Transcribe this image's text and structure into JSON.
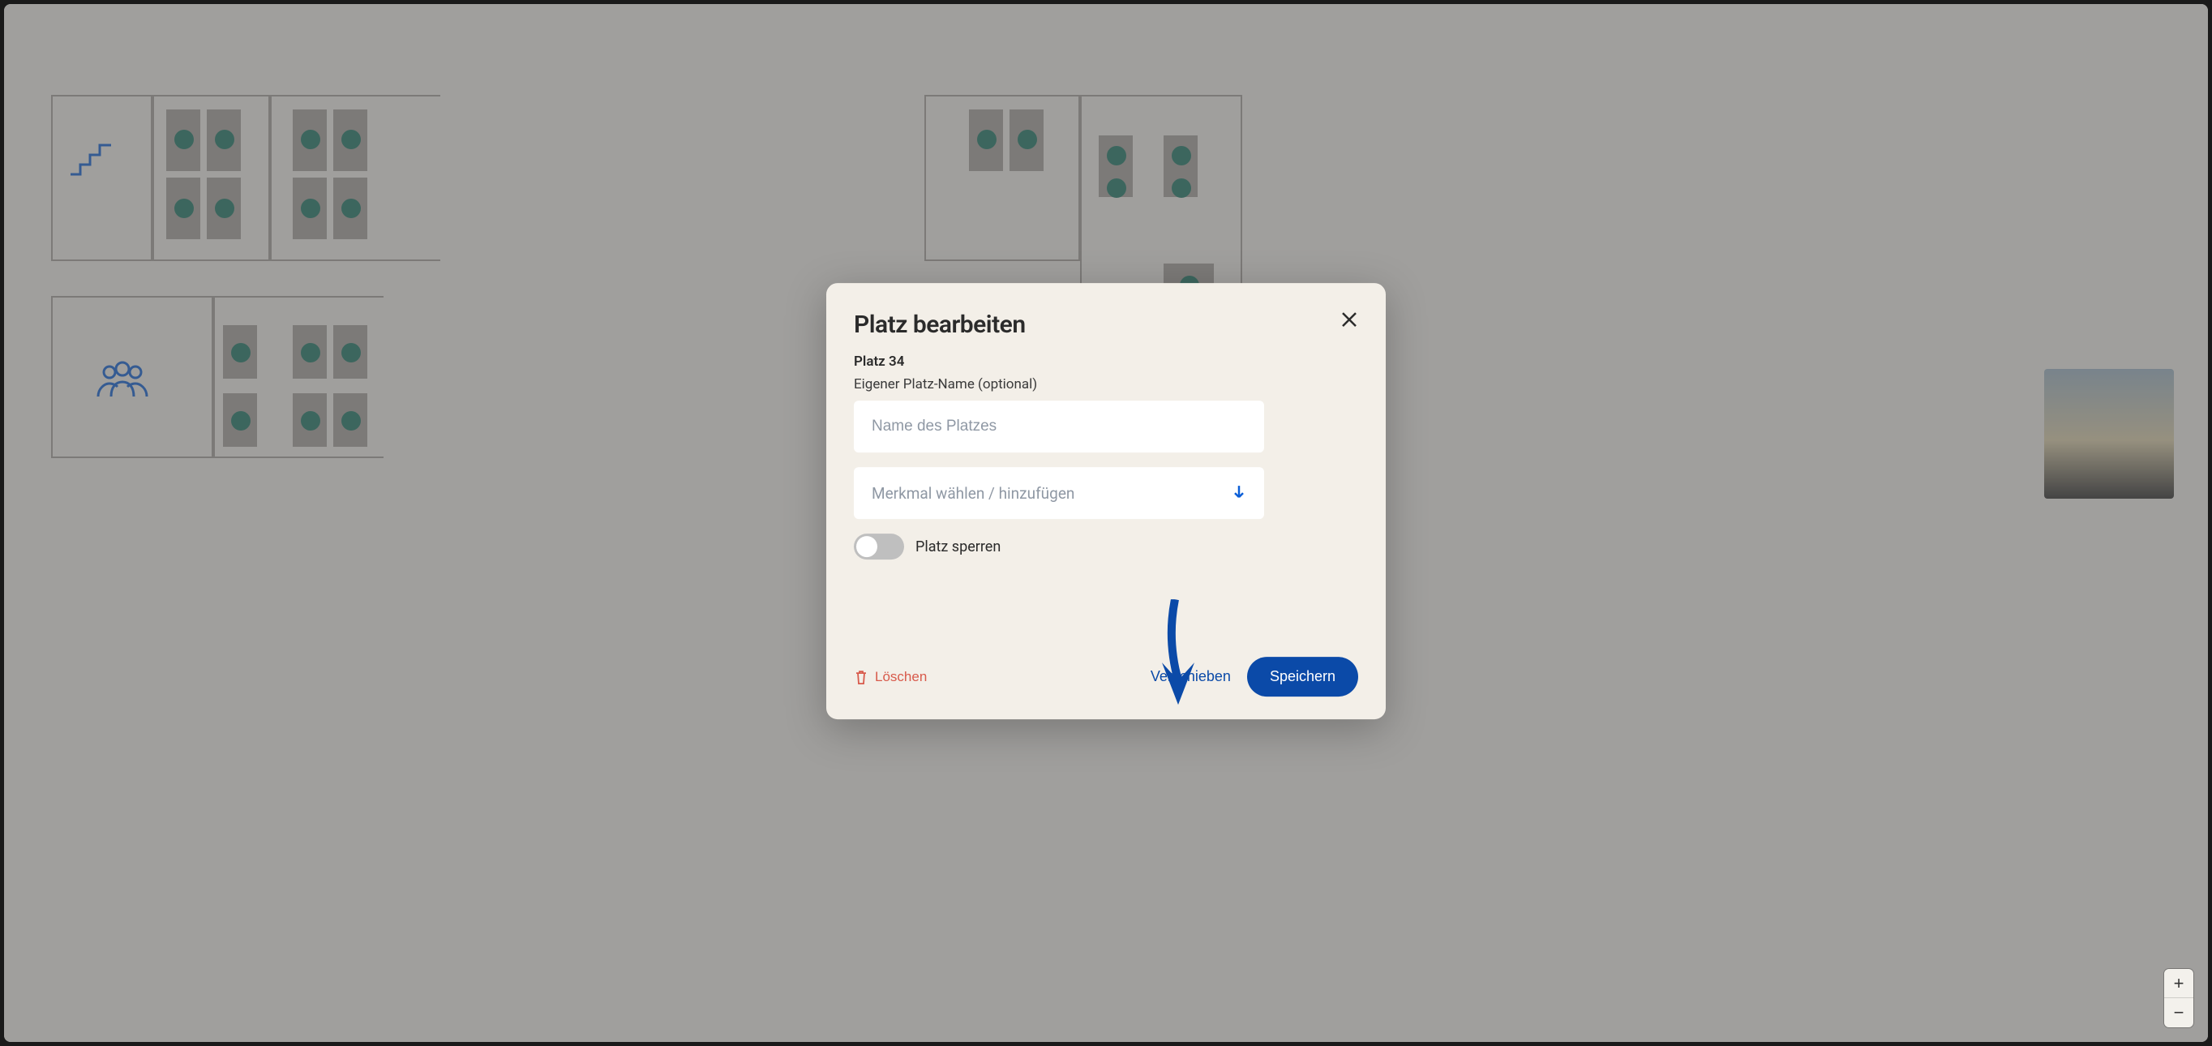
{
  "modal": {
    "title": "Platz bearbeiten",
    "subtitle": "Platz 34",
    "name_field_label": "Eigener Platz-Name (optional)",
    "name_field_placeholder": "Name des Platzes",
    "feature_select_placeholder": "Merkmal wählen / hinzufügen",
    "lock_toggle_label": "Platz sperren",
    "delete_label": "Löschen",
    "move_label": "Verschieben",
    "save_label": "Speichern"
  },
  "zoom": {
    "in": "+",
    "out": "−"
  },
  "colors": {
    "accent": "#0b4aa8",
    "danger": "#d85a4b",
    "seat": "#1a7765"
  }
}
